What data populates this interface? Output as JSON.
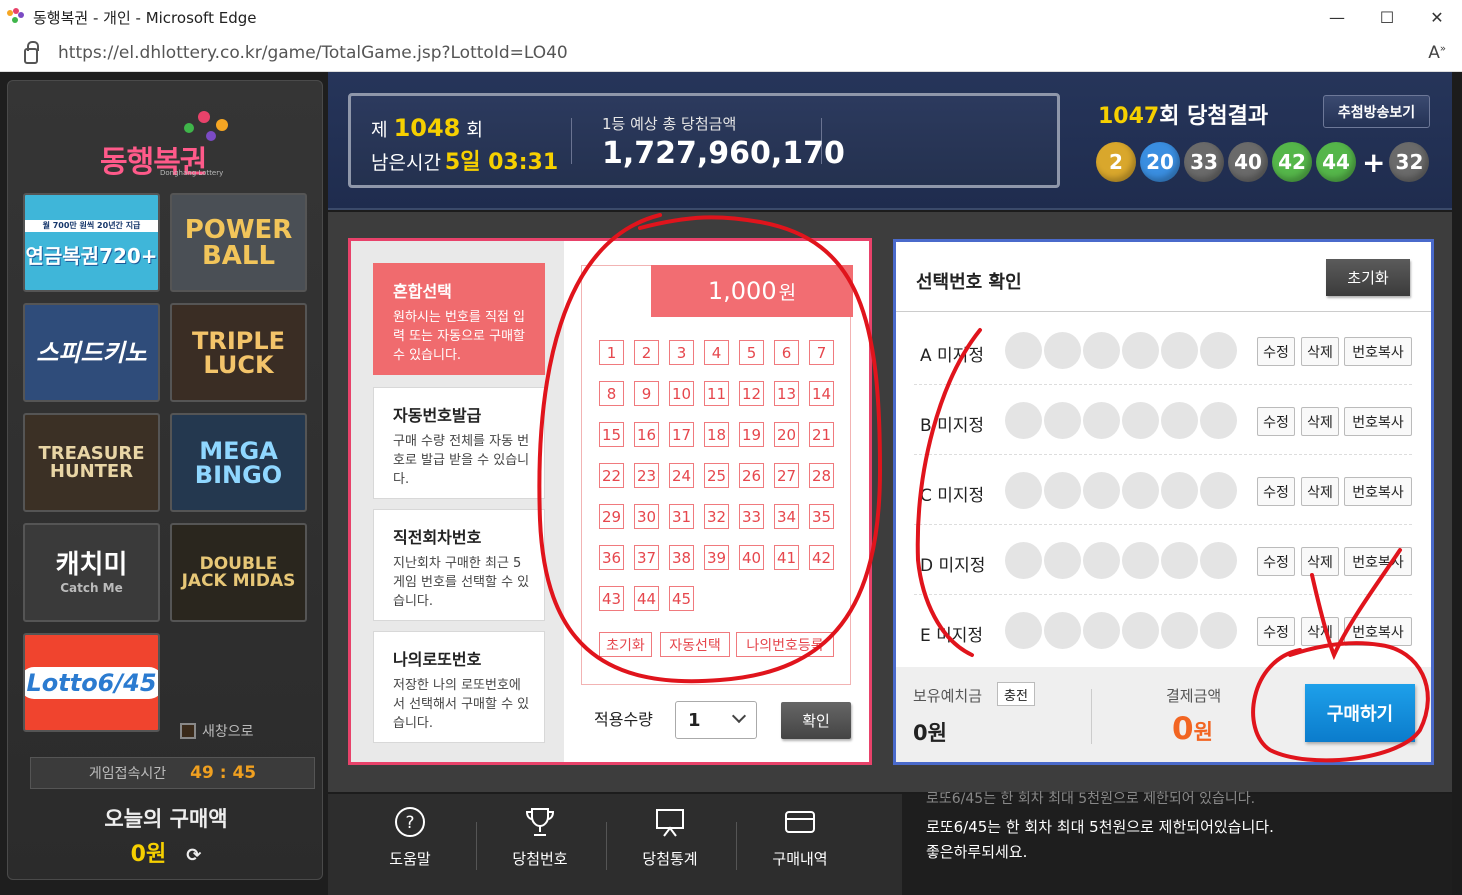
{
  "window": {
    "title": "동행복권 - 개인 - Microsoft Edge",
    "url": "https://el.dhlottery.co.kr/game/TotalGame.jsp?LottoId=LO40",
    "reader_label": "Ấ",
    "minimize": "—",
    "maximize": "☐",
    "close": "✕"
  },
  "sidebar": {
    "logo_text": "동행복권",
    "logo_sub": "Donghang Lottery",
    "games": [
      {
        "name": "연금복권720+",
        "badge": "월 700만 원씩 20년간 지급",
        "color": "#3fb6d9"
      },
      {
        "name": "POWER BALL",
        "color": "#4a4f55"
      },
      {
        "name": "스피드키노",
        "color": "#2f4c7a"
      },
      {
        "name": "TRIPLE LUCK",
        "color": "#3a2d24"
      },
      {
        "name": "TREASURE HUNTER",
        "color": "#3b3025"
      },
      {
        "name": "MEGA BINGO",
        "color": "#24384f"
      },
      {
        "name": "캐치미",
        "sub": "Catch Me",
        "color": "#3a3a3a"
      },
      {
        "name": "DOUBLE JACK MIDAS",
        "color": "#2a261e"
      },
      {
        "name": "Lotto6/45",
        "color": "#f0442e"
      }
    ],
    "new_window": "새창으로",
    "session_label": "게임접속시간",
    "session_time": "49 : 45",
    "today_label": "오늘의 구매액",
    "today_amount": "0원"
  },
  "header": {
    "round_prefix": "제",
    "round": "1048",
    "round_suffix": "회",
    "remaining_label": "남은시간",
    "remaining": "5일 03:31",
    "prize_label": "1등 예상 총 당첨금액",
    "prize_amount": "1,727,960,170",
    "result_round": "1047",
    "result_suffix": "회 당첨결과",
    "broadcast_btn": "추첨방송보기",
    "balls": [
      {
        "n": "2",
        "c": "#d9a72c"
      },
      {
        "n": "20",
        "c": "#3a8ee0"
      },
      {
        "n": "33",
        "c": "#6a6a6a"
      },
      {
        "n": "40",
        "c": "#6a6a6a"
      },
      {
        "n": "42",
        "c": "#55b64a"
      },
      {
        "n": "44",
        "c": "#55b64a"
      }
    ],
    "bonus": {
      "n": "32",
      "c": "#6a6a6a"
    }
  },
  "menu": [
    {
      "title": "혼합선택",
      "desc": "원하시는 번호를 직접 입력 또는 자동으로 구매할 수 있습니다.",
      "active": true
    },
    {
      "title": "자동번호발급",
      "desc": "구매 수량 전체를 자동 번호로 발급 받을 수 있습니다.",
      "active": false
    },
    {
      "title": "직전회차번호",
      "desc": "지난회차 구매한 최근 5게임 번호를 선택할 수 있습니다.",
      "active": false
    },
    {
      "title": "나의로또번호",
      "desc": "저장한 나의 로또번호에서 선택해서 구매할 수 있습니다.",
      "active": false
    }
  ],
  "picker": {
    "price": "1,000",
    "price_unit": "원",
    "numbers": [
      "1",
      "2",
      "3",
      "4",
      "5",
      "6",
      "7",
      "8",
      "9",
      "10",
      "11",
      "12",
      "13",
      "14",
      "15",
      "16",
      "17",
      "18",
      "19",
      "20",
      "21",
      "22",
      "23",
      "24",
      "25",
      "26",
      "27",
      "28",
      "29",
      "30",
      "31",
      "32",
      "33",
      "34",
      "35",
      "36",
      "37",
      "38",
      "39",
      "40",
      "41",
      "42",
      "43",
      "44",
      "45"
    ],
    "reset": "초기화",
    "auto": "자동선택",
    "mine": "나의번호등록",
    "qty_label": "적용수량",
    "qty_value": "1",
    "confirm": "확인"
  },
  "confirm_panel": {
    "title": "선택번호 확인",
    "reset": "초기화",
    "rows": [
      {
        "label": "A 미지정"
      },
      {
        "label": "B 미지정"
      },
      {
        "label": "C 미지정"
      },
      {
        "label": "D 미지정"
      },
      {
        "label": "E 미지정"
      }
    ],
    "edit": "수정",
    "delete": "삭제",
    "copy": "번호복사",
    "deposit_label": "보유예치금",
    "charge": "충전",
    "deposit_amount": "0원",
    "pay_label": "결제금액",
    "pay_amount": "0",
    "pay_unit": "원",
    "buy": "구매하기"
  },
  "bottom": {
    "items": [
      {
        "label": "도움말",
        "icon": "help-icon"
      },
      {
        "label": "당첨번호",
        "icon": "trophy-icon"
      },
      {
        "label": "당첨통계",
        "icon": "stats-icon"
      },
      {
        "label": "구매내역",
        "icon": "card-icon"
      }
    ],
    "notice_cut": "로또6/45는 한 회차 최대 5천원으로 제한되어 있습니다.",
    "notice1": "로또6/45는 한 회차 최대 5천원으로 제한되어있습니다.",
    "notice2": "좋은하루되세요."
  },
  "annotation_color": "#e0141c"
}
